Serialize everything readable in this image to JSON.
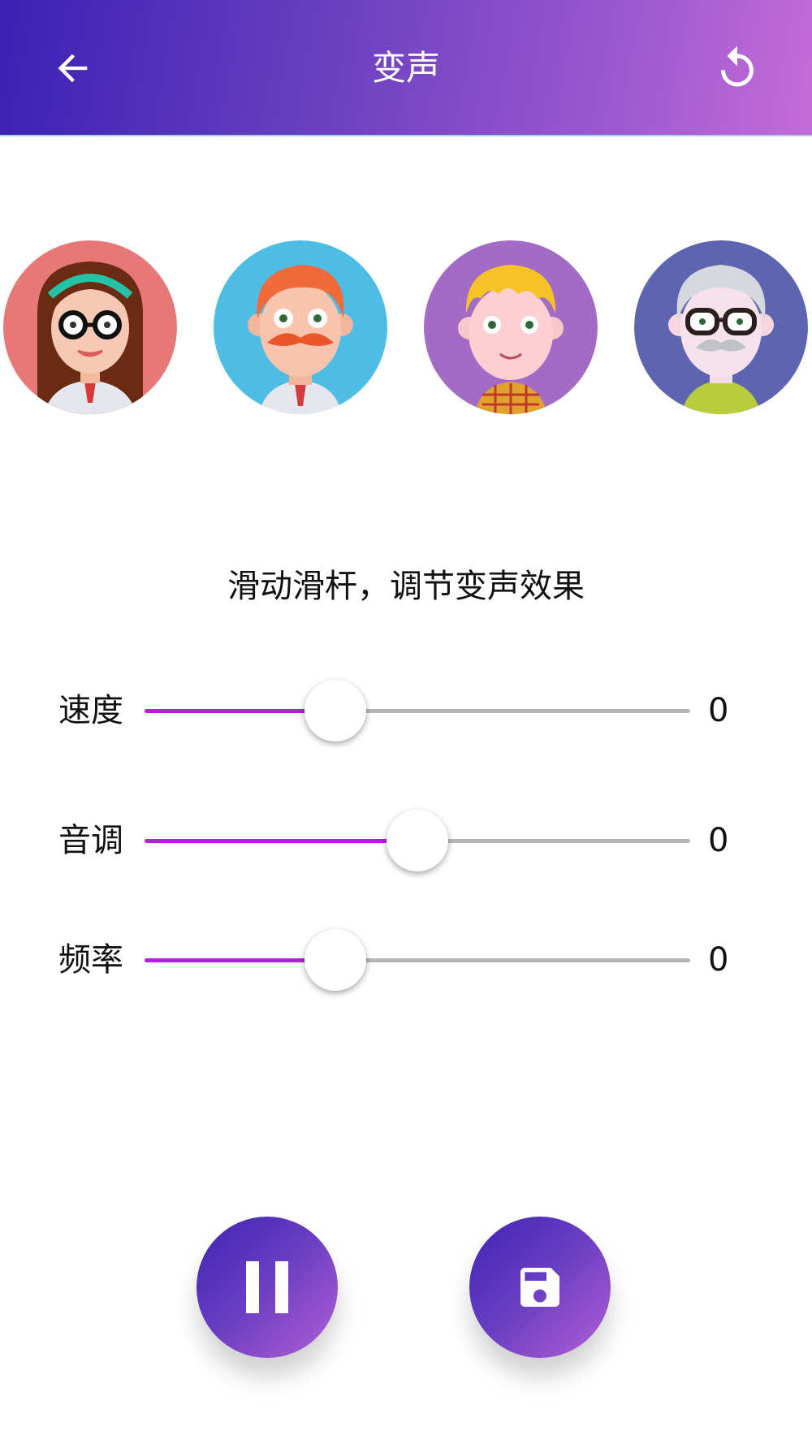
{
  "header": {
    "title": "变声",
    "back_icon": "arrow-left-icon",
    "refresh_icon": "refresh-icon",
    "gradient": [
      "#3a21b4",
      "#c56bd9"
    ]
  },
  "avatars": [
    {
      "name": "girl-avatar",
      "bg": "#e87878"
    },
    {
      "name": "mustache-man-avatar",
      "bg": "#4dbde3"
    },
    {
      "name": "boy-avatar",
      "bg": "#a16bc6"
    },
    {
      "name": "old-man-avatar",
      "bg": "#5d64b0"
    }
  ],
  "hint": "滑动滑杆，调节变声效果",
  "sliders": [
    {
      "label": "速度",
      "value": "0",
      "position": 0.35
    },
    {
      "label": "音调",
      "value": "0",
      "position": 0.5
    },
    {
      "label": "频率",
      "value": "0",
      "position": 0.35
    }
  ],
  "colors": {
    "accent": "#b31fd9",
    "track": "#b5b5b5"
  },
  "buttons": {
    "pause_icon": "pause-icon",
    "save_icon": "save-icon"
  }
}
